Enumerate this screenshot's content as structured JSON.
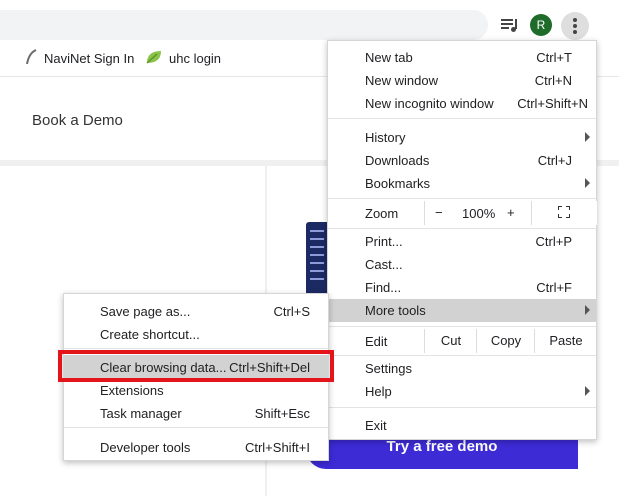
{
  "toolbar": {
    "avatar_letter": "R"
  },
  "bookmarks": [
    {
      "label": "NaviNet Sign In"
    },
    {
      "label": "uhc login"
    }
  ],
  "page": {
    "nav_link": "Book a Demo",
    "cta_button": "Try a free demo"
  },
  "main_menu": {
    "items": [
      {
        "label": "New tab",
        "shortcut": "Ctrl+T"
      },
      {
        "label": "New window",
        "shortcut": "Ctrl+N"
      },
      {
        "label": "New incognito window",
        "shortcut": "Ctrl+Shift+N"
      },
      {
        "label": "History",
        "shortcut": ""
      },
      {
        "label": "Downloads",
        "shortcut": "Ctrl+J"
      },
      {
        "label": "Bookmarks",
        "shortcut": ""
      },
      {
        "label": "Print...",
        "shortcut": "Ctrl+P"
      },
      {
        "label": "Cast...",
        "shortcut": ""
      },
      {
        "label": "Find...",
        "shortcut": "Ctrl+F"
      },
      {
        "label": "More tools",
        "shortcut": ""
      },
      {
        "label": "Settings",
        "shortcut": ""
      },
      {
        "label": "Help",
        "shortcut": ""
      },
      {
        "label": "Exit",
        "shortcut": ""
      }
    ],
    "zoom": {
      "label": "Zoom",
      "minus": "−",
      "level": "100%",
      "plus": "+"
    },
    "edit": {
      "label": "Edit",
      "cut": "Cut",
      "copy": "Copy",
      "paste": "Paste"
    }
  },
  "more_tools_menu": {
    "items": [
      {
        "label": "Save page as...",
        "shortcut": "Ctrl+S"
      },
      {
        "label": "Create shortcut...",
        "shortcut": ""
      },
      {
        "label": "Clear browsing data...",
        "shortcut": "Ctrl+Shift+Del"
      },
      {
        "label": "Extensions",
        "shortcut": ""
      },
      {
        "label": "Task manager",
        "shortcut": "Shift+Esc"
      },
      {
        "label": "Developer tools",
        "shortcut": "Ctrl+Shift+I"
      }
    ]
  },
  "colors": {
    "highlight_box": "#e3141a",
    "avatar": "#1e6b2a",
    "cta": "#3d2bd6"
  }
}
